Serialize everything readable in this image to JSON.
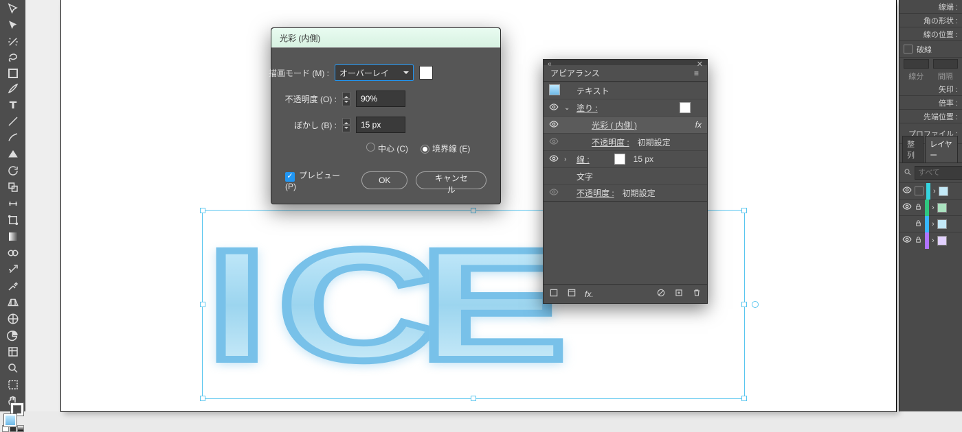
{
  "canvas_text": "ICE",
  "dialog": {
    "title": "光彩 (内側)",
    "mode_label": "描画モード (M) :",
    "mode_value": "オーバーレイ",
    "opacity_label": "不透明度 (O) :",
    "opacity_value": "90%",
    "blur_label": "ぼかし (B) :",
    "blur_value": "15 px",
    "origin_center": "中心 (C)",
    "origin_edge": "境界線 (E)",
    "origin_selected": "edge",
    "preview_label": "プレビュー (P)",
    "ok": "OK",
    "cancel": "キャンセル",
    "color": "#ffffff"
  },
  "appearance": {
    "tab": "アピアランス",
    "target": "テキスト",
    "rows": {
      "fill_label": "塗り :",
      "effect_label": "光彩 ( 内側 )",
      "fx": "fx",
      "opacity_label": "不透明度 :",
      "opacity_value": "初期設定",
      "stroke_label": "線 :",
      "stroke_value": "15 px",
      "char_label": "文字",
      "opacity2_label": "不透明度 :",
      "opacity2_value": "初期設定"
    },
    "footer_fx": "fx."
  },
  "right": {
    "cap": "線端 :",
    "corner": "角の形状 :",
    "align": "線の位置 :",
    "dashed": "破線",
    "dash_a": "線分",
    "dash_b": "間隔",
    "arrow": "矢印 :",
    "scale": "倍率 :",
    "tipalign": "先端位置 :",
    "profile": "プロファイル :",
    "tab_align": "整列",
    "tab_layers": "レイヤー",
    "search_placeholder": "すべて"
  }
}
